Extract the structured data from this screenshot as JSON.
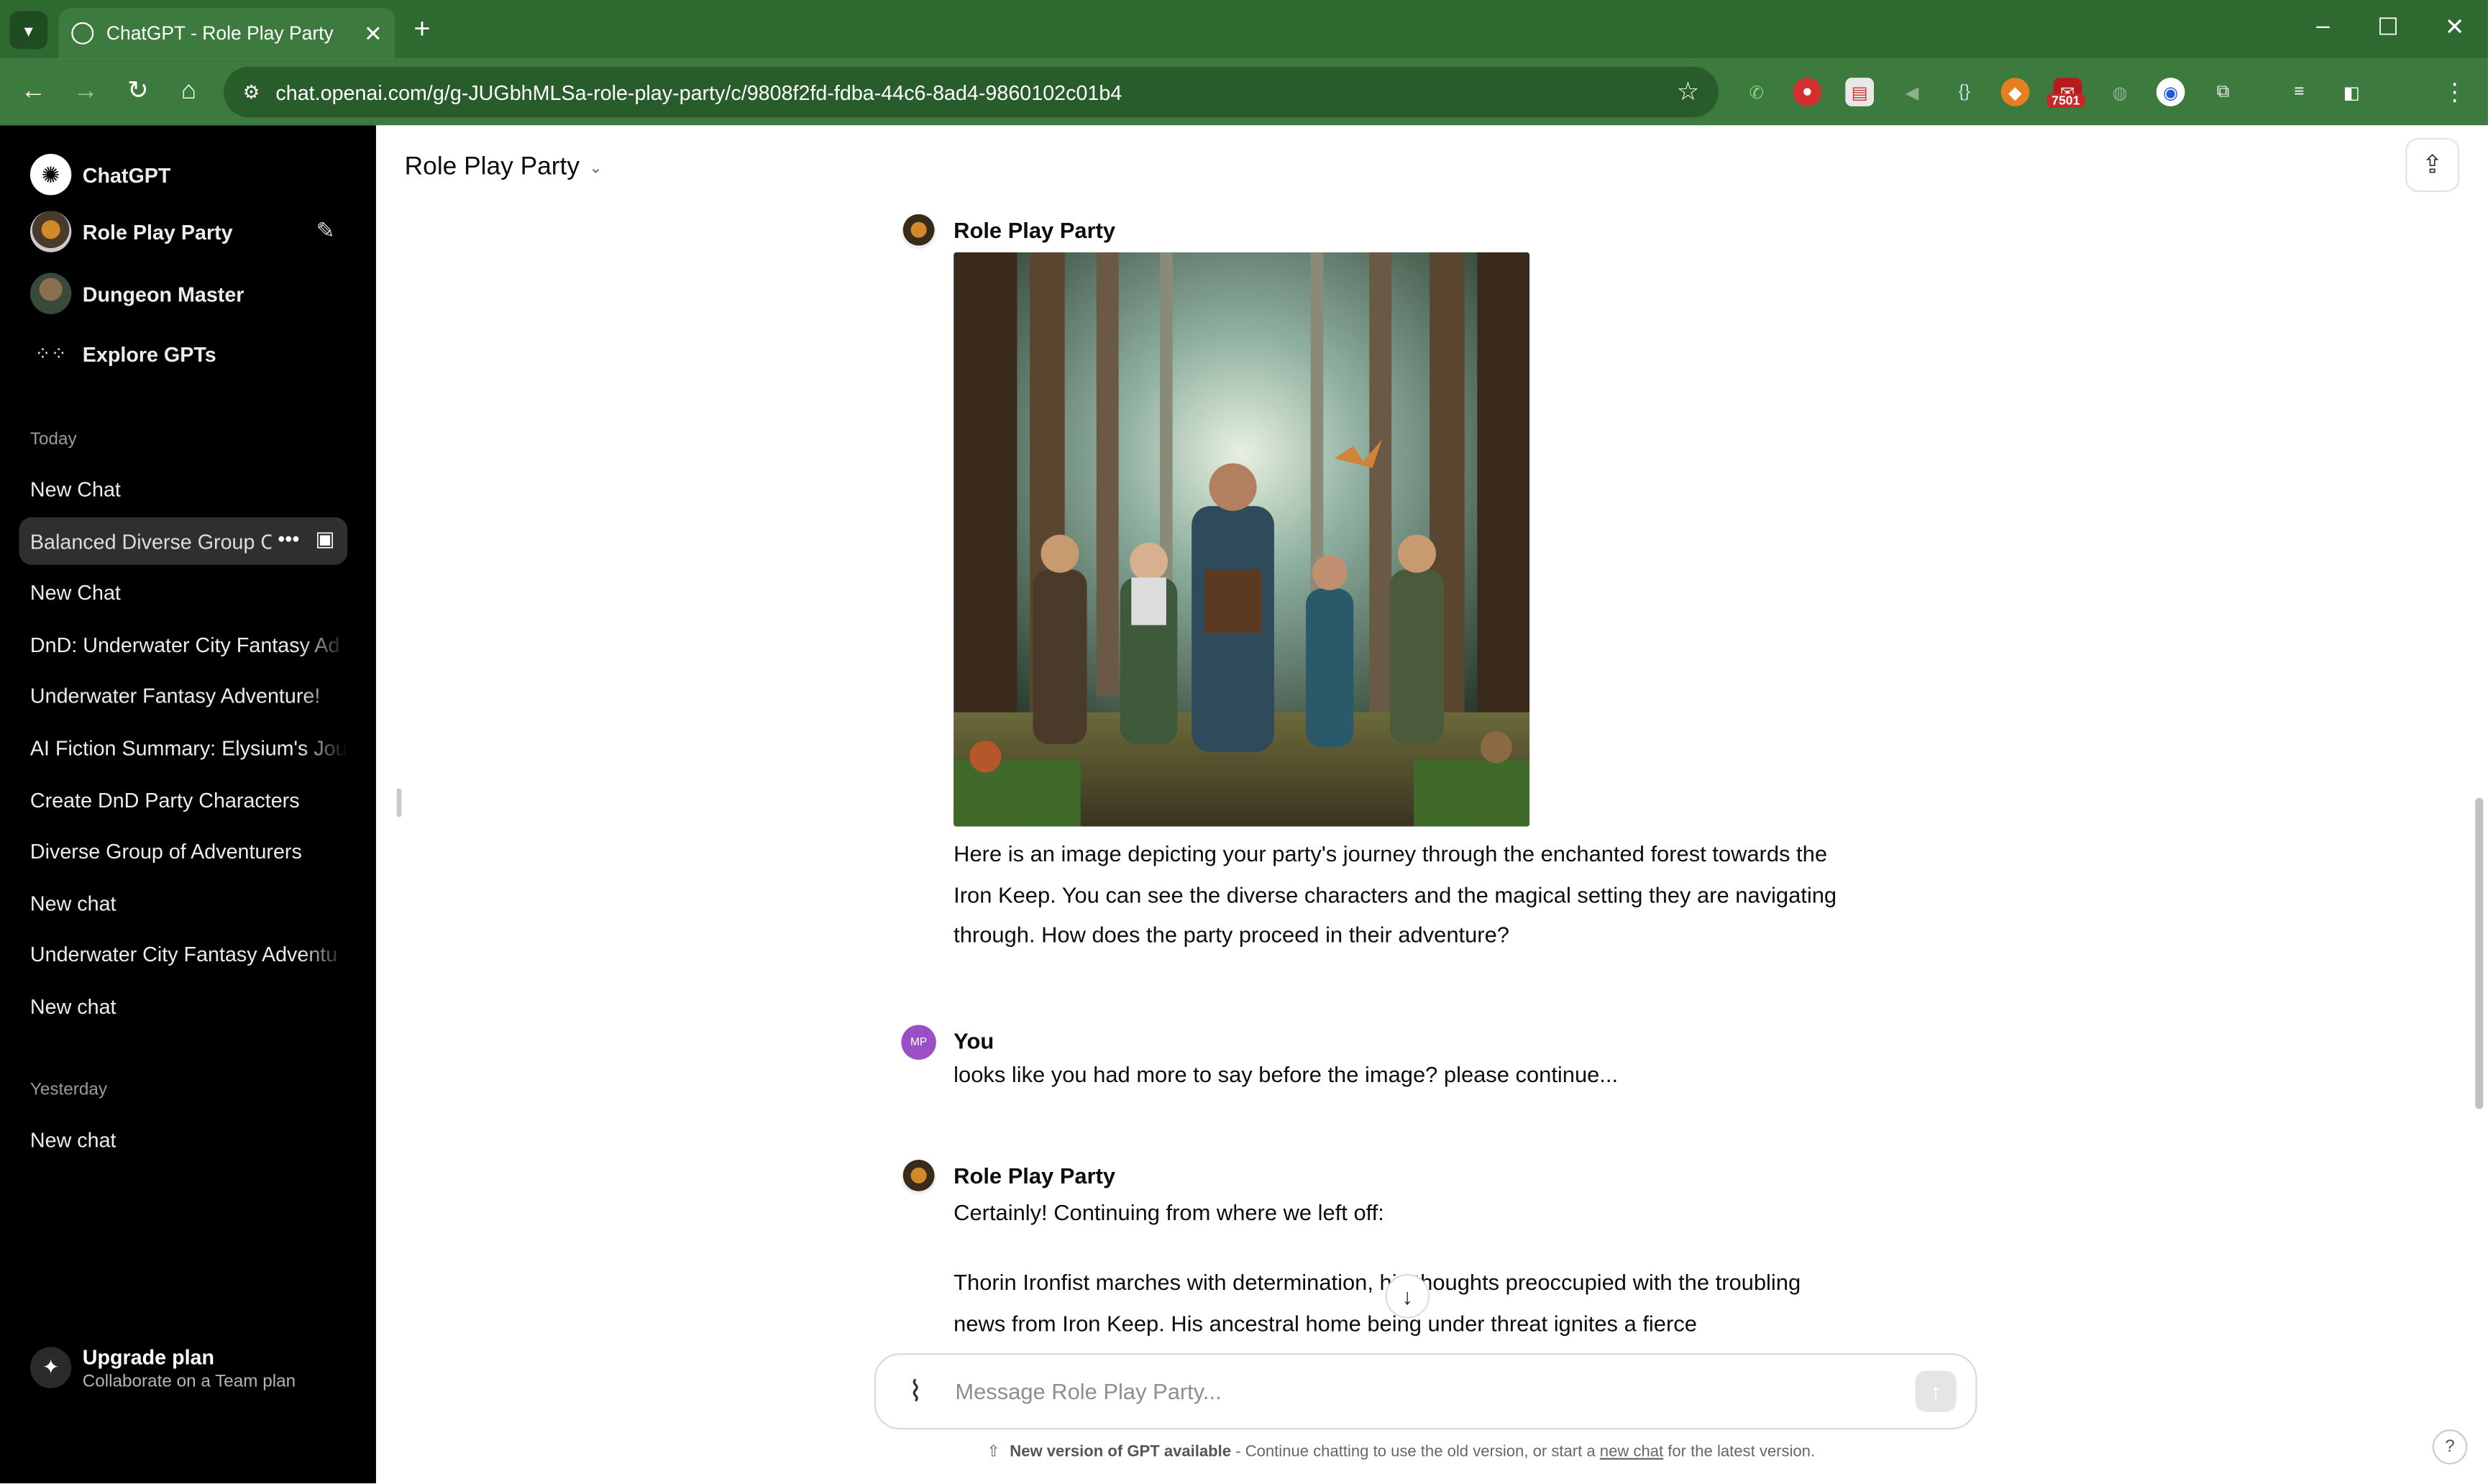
{
  "browser": {
    "tab_title": "ChatGPT - Role Play Party",
    "url": "chat.openai.com/g/g-JUGbhMLSa-role-play-party/c/9808f2fd-fdba-44c6-8ad4-9860102c01b4",
    "extension_badge": "7501",
    "theme_color": "#3d7a3e"
  },
  "sidebar": {
    "header": [
      {
        "label": "ChatGPT"
      },
      {
        "label": "Role Play Party"
      },
      {
        "label": "Dungeon Master"
      },
      {
        "label": "Explore GPTs"
      }
    ],
    "today_label": "Today",
    "today": [
      "New Chat",
      "Balanced Diverse Group C",
      "New Chat",
      "DnD: Underwater City Fantasy Ad",
      "Underwater Fantasy Adventure!",
      "AI Fiction Summary: Elysium's Jou",
      "Create DnD Party Characters",
      "Diverse Group of Adventurers",
      "New chat",
      "Underwater City Fantasy Adventu",
      "New chat"
    ],
    "yesterday_label": "Yesterday",
    "yesterday": [
      "New chat"
    ],
    "upgrade": {
      "title": "Upgrade plan",
      "subtitle": "Collaborate on a Team plan"
    }
  },
  "main": {
    "title": "Role Play Party",
    "messages": [
      {
        "author": "Role Play Party",
        "text": "Here is an image depicting your party's journey through the enchanted forest towards the Iron Keep. You can see the diverse characters and the magical setting they are navigating through. How does the party proceed in their adventure?"
      },
      {
        "author": "You",
        "avatar_initials": "MP",
        "text": "looks like you had more to say before the image? please continue..."
      },
      {
        "author": "Role Play Party",
        "text": "Certainly! Continuing from where we left off:",
        "text2": "Thorin Ironfist marches with determination, his thoughts preoccupied with the troubling news from Iron Keep. His ancestral home being under threat ignites a fierce"
      }
    ],
    "composer_placeholder": "Message Role Play Party...",
    "notice": {
      "bold": "New version of GPT available",
      "middle": " - Continue chatting to use the old version, or start a ",
      "link": "new chat",
      "end": " for the latest version."
    },
    "help": "?"
  }
}
